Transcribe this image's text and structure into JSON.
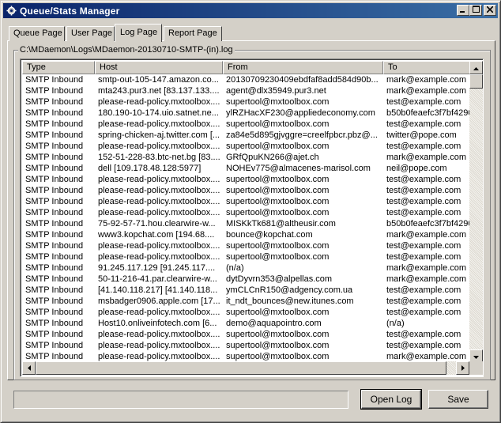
{
  "window": {
    "title": "Queue/Stats Manager"
  },
  "tabs": [
    {
      "label": "Queue Page"
    },
    {
      "label": "User Page"
    },
    {
      "label": "Log Page"
    },
    {
      "label": "Report Page"
    }
  ],
  "log": {
    "path": "C:\\MDaemon\\Logs\\MDaemon-20130710-SMTP-(in).log",
    "columns": [
      "Type",
      "Host",
      "From",
      "To"
    ],
    "rows": [
      [
        "SMTP Inbound",
        "smtp-out-105-147.amazon.co...",
        "20130709230409ebdfaf8add584d90b...",
        "mark@example.com"
      ],
      [
        "SMTP Inbound",
        "mta243.pur3.net [83.137.133....",
        "agent@dlx35949.pur3.net",
        "mark@example.com"
      ],
      [
        "SMTP Inbound",
        "please-read-policy.mxtoolbox....",
        "supertool@mxtoolbox.com",
        "test@example.com"
      ],
      [
        "SMTP Inbound",
        "180.190-10-174.uio.satnet.ne...",
        "ylRZHacXF230@appliedeconomy.com",
        "b50b0feaefc3f7bf4290"
      ],
      [
        "SMTP Inbound",
        "please-read-policy.mxtoolbox....",
        "supertool@mxtoolbox.com",
        "test@example.com"
      ],
      [
        "SMTP Inbound",
        "spring-chicken-aj.twitter.com [...",
        "za84e5d895gjvggre=creelfpbcr.pbz@...",
        "twitter@pope.com"
      ],
      [
        "SMTP Inbound",
        "please-read-policy.mxtoolbox....",
        "supertool@mxtoolbox.com",
        "test@example.com"
      ],
      [
        "SMTP Inbound",
        "152-51-228-83.btc-net.bg [83....",
        "GRfQpuKN266@ajet.ch",
        "mark@example.com"
      ],
      [
        "SMTP Inbound",
        "dell [109.178.48.128:5977]",
        "NOHEv775@almacenes-marisol.com",
        "neil@pope.com"
      ],
      [
        "SMTP Inbound",
        "please-read-policy.mxtoolbox....",
        "supertool@mxtoolbox.com",
        "test@example.com"
      ],
      [
        "SMTP Inbound",
        "please-read-policy.mxtoolbox....",
        "supertool@mxtoolbox.com",
        "test@example.com"
      ],
      [
        "SMTP Inbound",
        "please-read-policy.mxtoolbox....",
        "supertool@mxtoolbox.com",
        "test@example.com"
      ],
      [
        "SMTP Inbound",
        "please-read-policy.mxtoolbox....",
        "supertool@mxtoolbox.com",
        "test@example.com"
      ],
      [
        "SMTP Inbound",
        "75-92-57-71.hou.clearwire-w...",
        "MISKkTk681@altheusir.com",
        "b50b0feaefc3f7bf4290"
      ],
      [
        "SMTP Inbound",
        "www3.kopchat.com [194.68....",
        "bounce@kopchat.com",
        "mark@example.com"
      ],
      [
        "SMTP Inbound",
        "please-read-policy.mxtoolbox....",
        "supertool@mxtoolbox.com",
        "test@example.com"
      ],
      [
        "SMTP Inbound",
        "please-read-policy.mxtoolbox....",
        "supertool@mxtoolbox.com",
        "test@example.com"
      ],
      [
        "SMTP Inbound",
        "91.245.117.129 [91.245.117....",
        "(n/a)",
        "mark@example.com"
      ],
      [
        "SMTP Inbound",
        "50-11-216-41.par.clearwire-w...",
        "dytDyvrn353@alpellas.com",
        "mark@example.com"
      ],
      [
        "SMTP Inbound",
        "[41.140.118.217] [41.140.118...",
        "ymCLCnR150@adgency.com.ua",
        "test@example.com"
      ],
      [
        "SMTP Inbound",
        "msbadger0906.apple.com [17...",
        "it_ndt_bounces@new.itunes.com",
        "test@example.com"
      ],
      [
        "SMTP Inbound",
        "please-read-policy.mxtoolbox....",
        "supertool@mxtoolbox.com",
        "test@example.com"
      ],
      [
        "SMTP Inbound",
        "Host10.onliveinfotech.com [6...",
        "demo@aquapointro.com",
        "(n/a)"
      ],
      [
        "SMTP Inbound",
        "please-read-policy.mxtoolbox....",
        "supertool@mxtoolbox.com",
        "test@example.com"
      ],
      [
        "SMTP Inbound",
        "please-read-policy.mxtoolbox....",
        "supertool@mxtoolbox.com",
        "test@example.com"
      ],
      [
        "SMTP Inbound",
        "please-read-policy.mxtoolbox....",
        "supertool@mxtoolbox.com",
        "mark@example.com"
      ]
    ]
  },
  "buttons": {
    "open_log": "Open Log",
    "save": "Save"
  },
  "icons": {
    "app": "gear-icon",
    "minimize": "minimize-icon",
    "maximize": "maximize-icon",
    "close": "close-icon",
    "scroll_up": "arrow-up-icon",
    "scroll_down": "arrow-down-icon",
    "scroll_left": "arrow-left-icon",
    "scroll_right": "arrow-right-icon"
  },
  "colors": {
    "titlebar_start": "#0a246a",
    "titlebar_end": "#3a6ea5",
    "face": "#d4d0c8"
  }
}
